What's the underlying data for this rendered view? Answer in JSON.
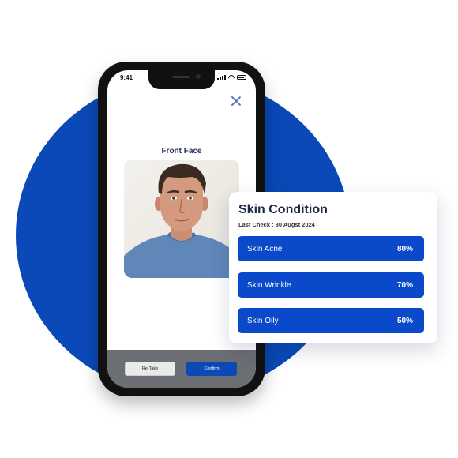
{
  "phone": {
    "status_time": "9:41",
    "screen_title": "Front Face",
    "buttons": {
      "retake": "Re-Take",
      "confirm": "Confirm"
    }
  },
  "skin_card": {
    "title": "Skin Condition",
    "last_check": "Last Check : 30 Augst 2024",
    "metrics": [
      {
        "label": "Skin Acne",
        "value": "80%"
      },
      {
        "label": "Skin Wrinkle",
        "value": "70%"
      },
      {
        "label": "Skin Oily",
        "value": "50%"
      }
    ]
  },
  "colors": {
    "brand_blue": "#0a49b7",
    "metric_blue": "#0a49c9",
    "title_navy": "#1d2748",
    "close_icon": "#5b73b8",
    "bottom_bar": "#6b6e72"
  }
}
